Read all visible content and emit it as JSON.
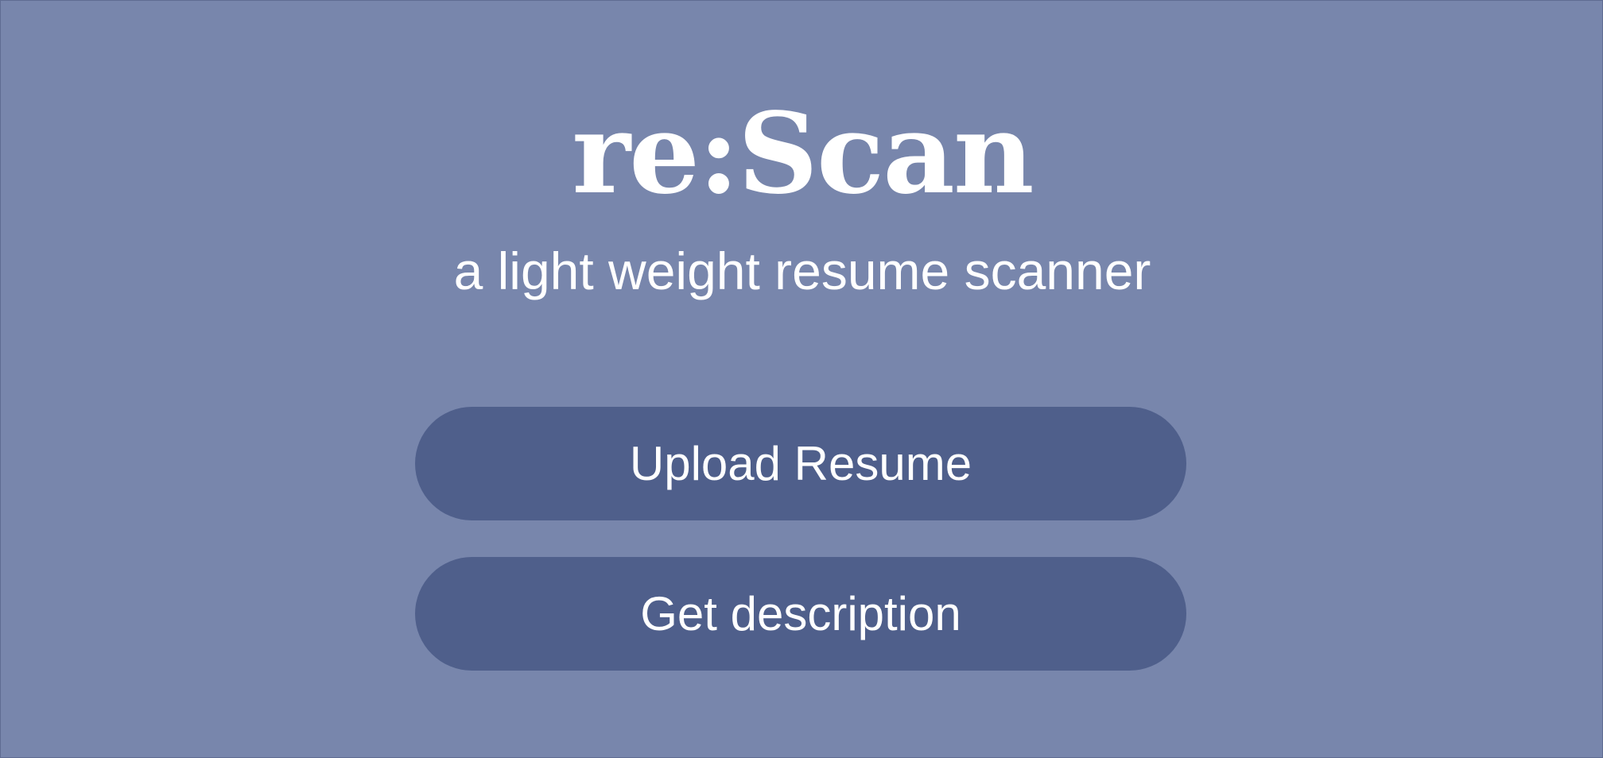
{
  "app": {
    "title": "re:Scan",
    "tagline": "a light weight resume scanner"
  },
  "actions": {
    "upload_label": "Upload Resume",
    "description_label": "Get description"
  },
  "colors": {
    "background": "#7886ac",
    "button": "#4f5f8b",
    "text": "#ffffff"
  }
}
